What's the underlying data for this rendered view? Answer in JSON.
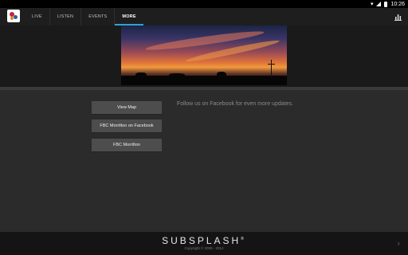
{
  "status_bar": {
    "time": "10:26"
  },
  "header": {
    "tabs": [
      {
        "label": "LIVE"
      },
      {
        "label": "LISTEN"
      },
      {
        "label": "EVENTS"
      },
      {
        "label": "MORE"
      }
    ],
    "active_tab": "MORE",
    "accent_color": "#2ba4d8",
    "right_icon": "stats-icon"
  },
  "main": {
    "buttons": [
      {
        "label": "View Map"
      },
      {
        "label": "FBC Morrilton on Facebook"
      },
      {
        "label": "FBC Morrilton"
      }
    ],
    "description": "Follow us on Facebook for even more updates."
  },
  "footer": {
    "brand": "SUBSPLASH",
    "trademark": "®",
    "copyright": "Copyright © 2009 - 2014"
  }
}
